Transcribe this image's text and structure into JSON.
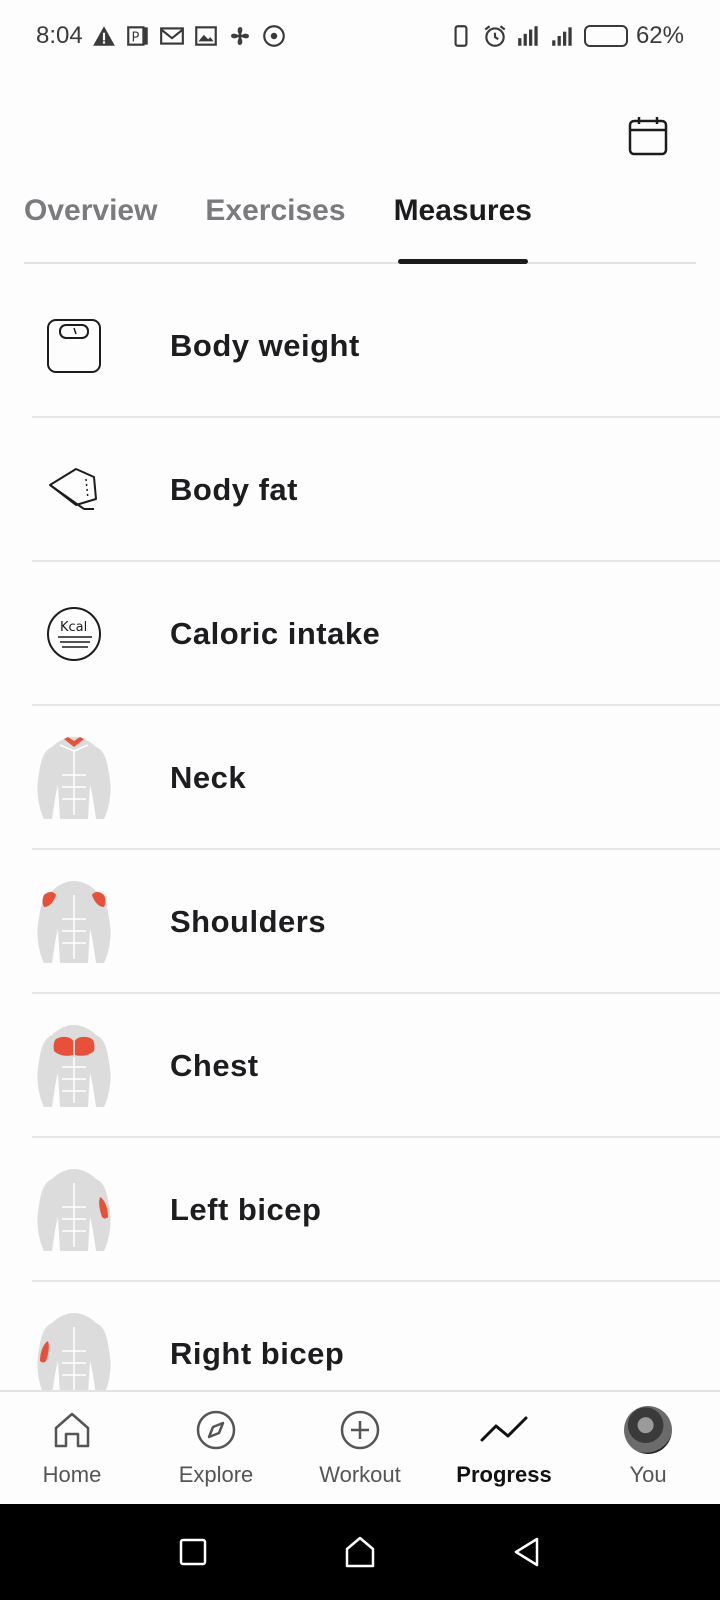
{
  "status_bar": {
    "time": "8:04",
    "battery": "62%",
    "battery_level": 0.62
  },
  "header": {
    "calendar_icon": "calendar-icon"
  },
  "tabs": [
    {
      "label": "Overview",
      "active": false
    },
    {
      "label": "Exercises",
      "active": false
    },
    {
      "label": "Measures",
      "active": true
    }
  ],
  "measures": [
    {
      "label": "Body weight",
      "icon": "scale-icon"
    },
    {
      "label": "Body fat",
      "icon": "caliper-icon"
    },
    {
      "label": "Caloric intake",
      "icon": "kcal-icon"
    },
    {
      "label": "Neck",
      "icon": "body-neck-icon"
    },
    {
      "label": "Shoulders",
      "icon": "body-shoulders-icon"
    },
    {
      "label": "Chest",
      "icon": "body-chest-icon"
    },
    {
      "label": "Left bicep",
      "icon": "body-left-bicep-icon"
    },
    {
      "label": "Right bicep",
      "icon": "body-right-bicep-icon"
    }
  ],
  "bottom_nav": [
    {
      "label": "Home",
      "icon": "home-icon",
      "active": false
    },
    {
      "label": "Explore",
      "icon": "compass-icon",
      "active": false
    },
    {
      "label": "Workout",
      "icon": "plus-circle-icon",
      "active": false
    },
    {
      "label": "Progress",
      "icon": "trend-icon",
      "active": true
    },
    {
      "label": "You",
      "icon": "avatar",
      "active": false
    }
  ],
  "colors": {
    "muscle_highlight": "#e8503a",
    "body_gray": "#dcdcdc",
    "text_primary": "#1c1c1e",
    "tab_inactive": "#7a7a7f"
  }
}
